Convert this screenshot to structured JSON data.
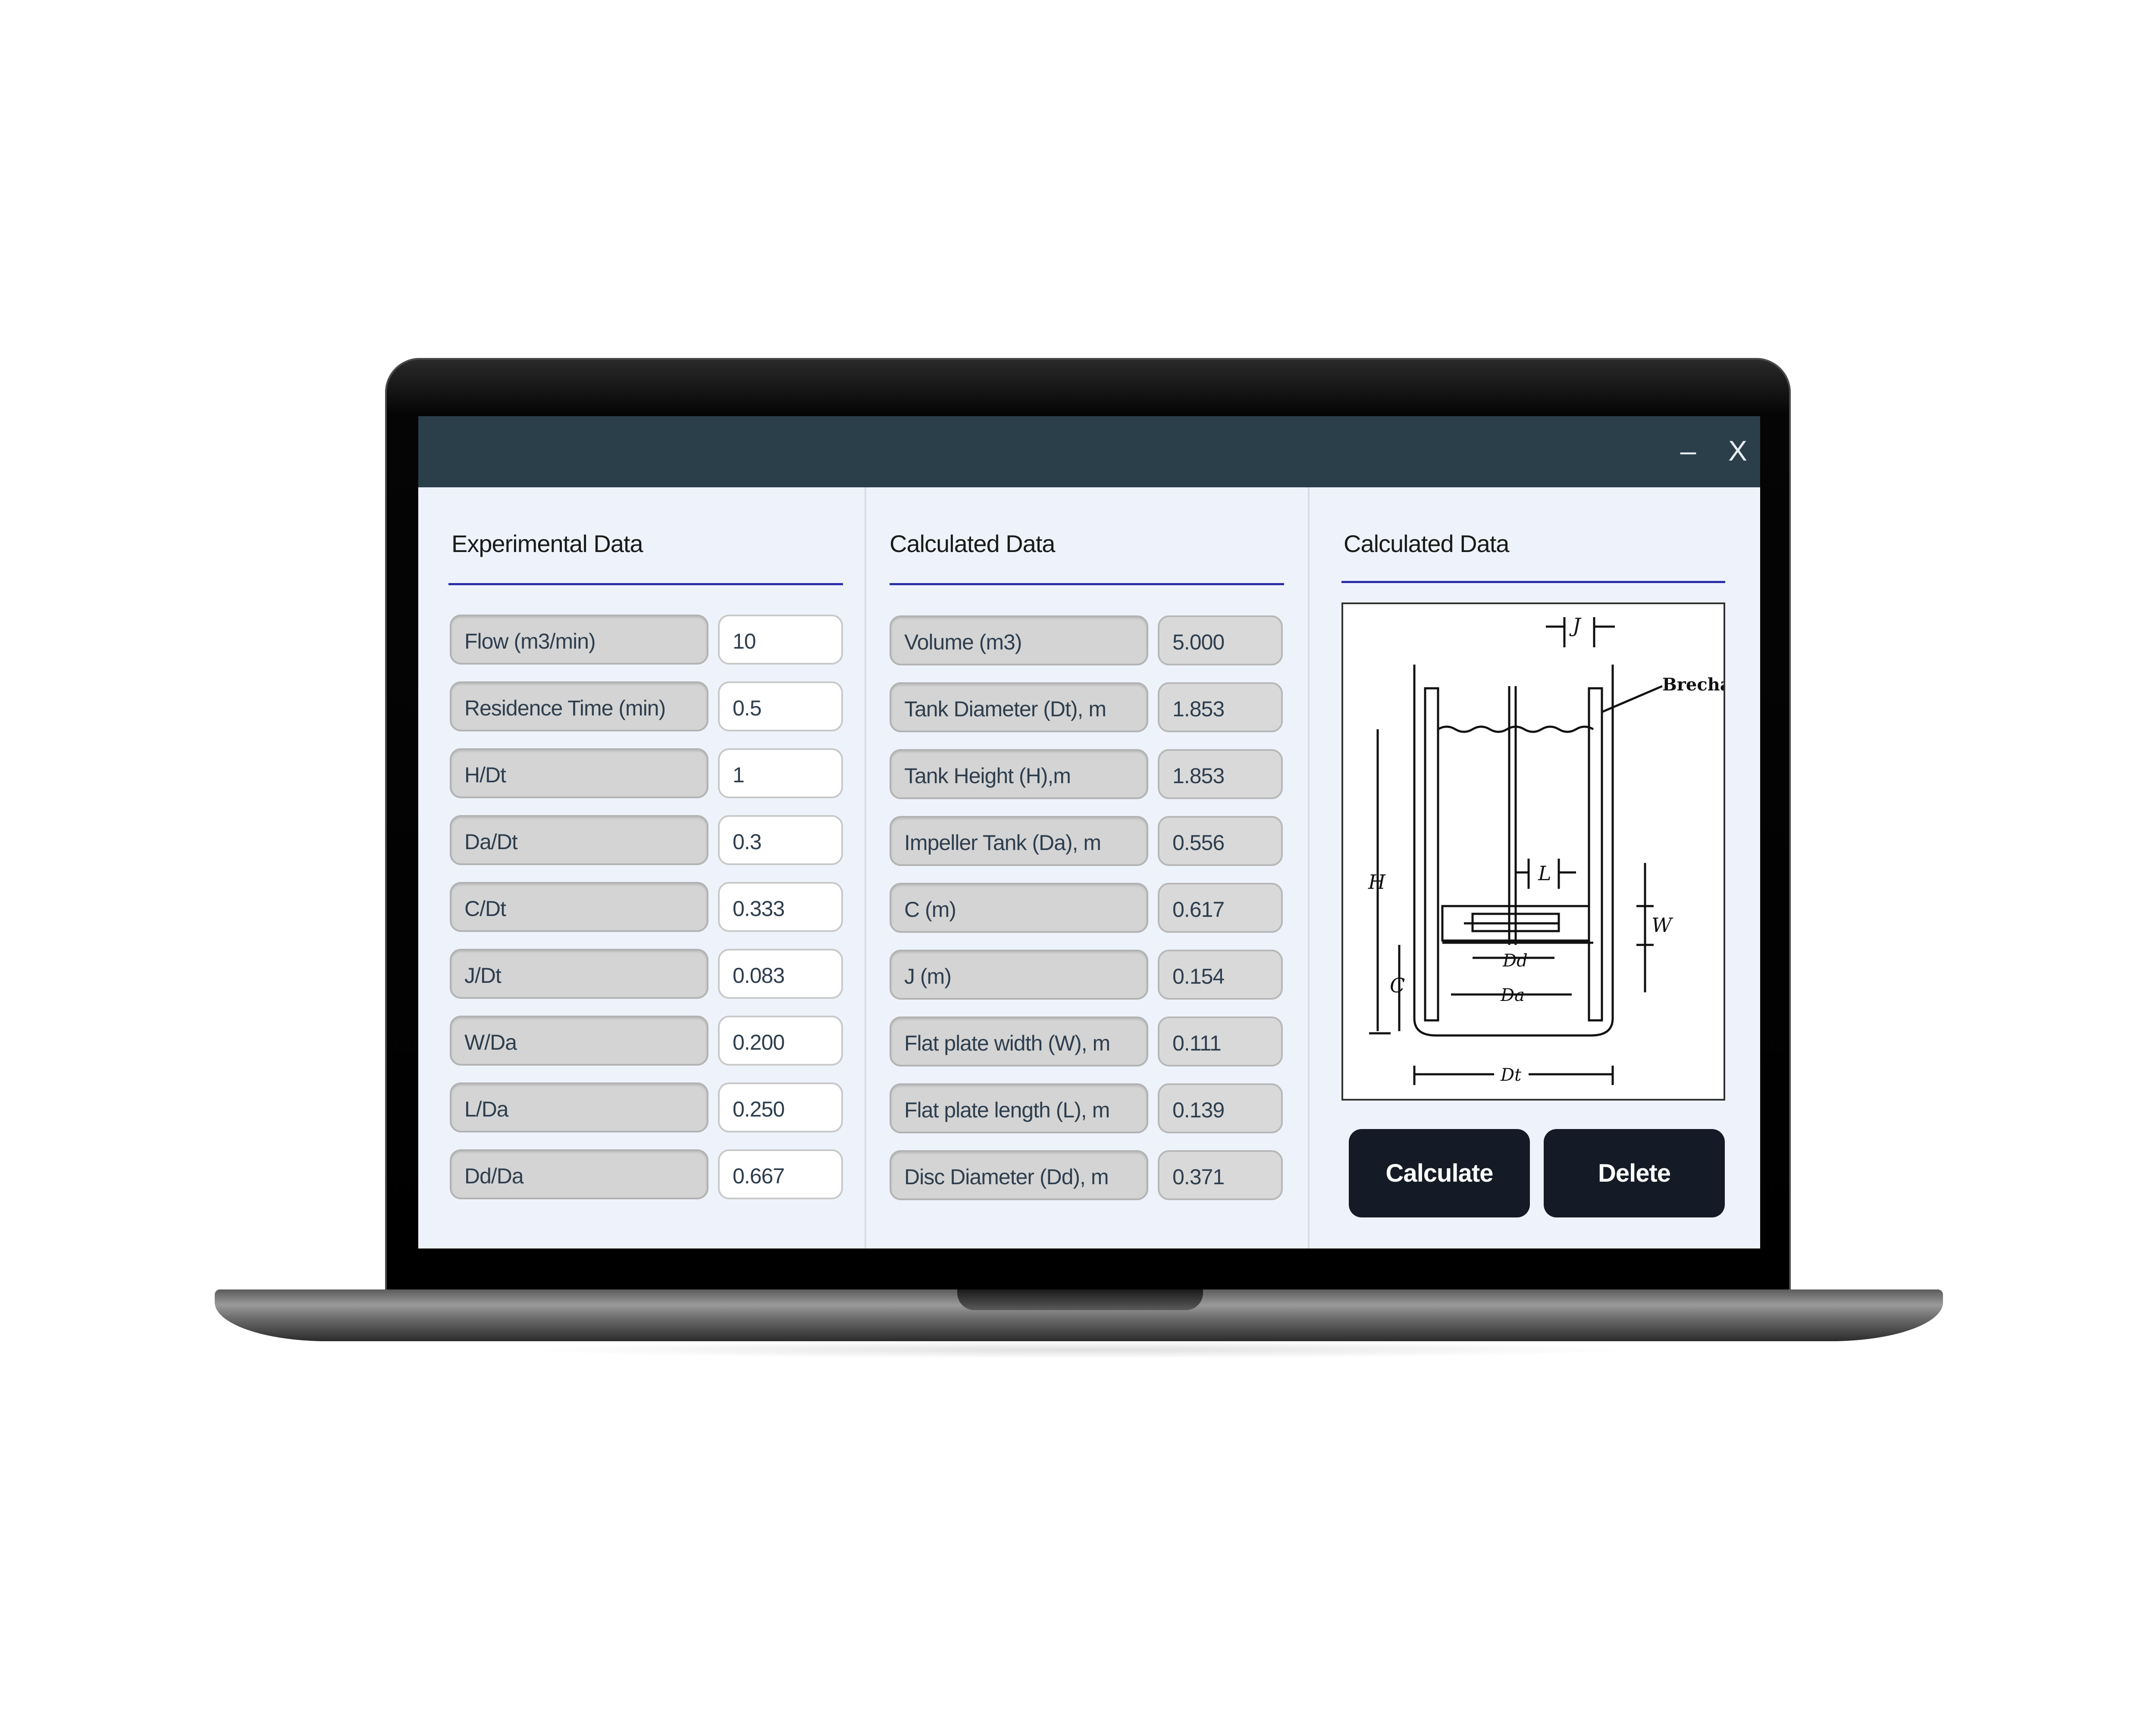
{
  "window": {
    "minimize_glyph": "–",
    "close_glyph": "X"
  },
  "experimental": {
    "title": "Experimental Data",
    "rows": [
      {
        "label": "Flow (m3/min)",
        "value": "10"
      },
      {
        "label": "Residence Time (min)",
        "value": "0.5"
      },
      {
        "label": "H/Dt",
        "value": "1"
      },
      {
        "label": "Da/Dt",
        "value": "0.3"
      },
      {
        "label": "C/Dt",
        "value": "0.333"
      },
      {
        "label": "J/Dt",
        "value": "0.083"
      },
      {
        "label": "W/Da",
        "value": "0.200"
      },
      {
        "label": "L/Da",
        "value": "0.250"
      },
      {
        "label": "Dd/Da",
        "value": "0.667"
      }
    ]
  },
  "calculated": {
    "title": "Calculated Data",
    "rows": [
      {
        "label": "Volume (m3)",
        "value": "5.000"
      },
      {
        "label": "Tank Diameter (Dt), m",
        "value": "1.853"
      },
      {
        "label": "Tank Height (H),m",
        "value": "1.853"
      },
      {
        "label": "Impeller Tank (Da), m",
        "value": "0.556"
      },
      {
        "label": "C (m)",
        "value": "0.617"
      },
      {
        "label": "J (m)",
        "value": "0.154"
      },
      {
        "label": "Flat plate width (W), m",
        "value": "0.111"
      },
      {
        "label": "Flat plate length (L), m",
        "value": "0.139"
      },
      {
        "label": "Disc Diameter (Dd), m",
        "value": "0.371"
      }
    ]
  },
  "diagram_panel": {
    "title": "Calculated Data",
    "labels": {
      "j": "J",
      "brecha": "Brecha",
      "h": "H",
      "l": "L",
      "w": "W",
      "c": "C",
      "dd": "Dd",
      "da": "Da",
      "dt": "Dt"
    }
  },
  "actions": {
    "calculate": "Calculate",
    "delete": "Delete"
  }
}
